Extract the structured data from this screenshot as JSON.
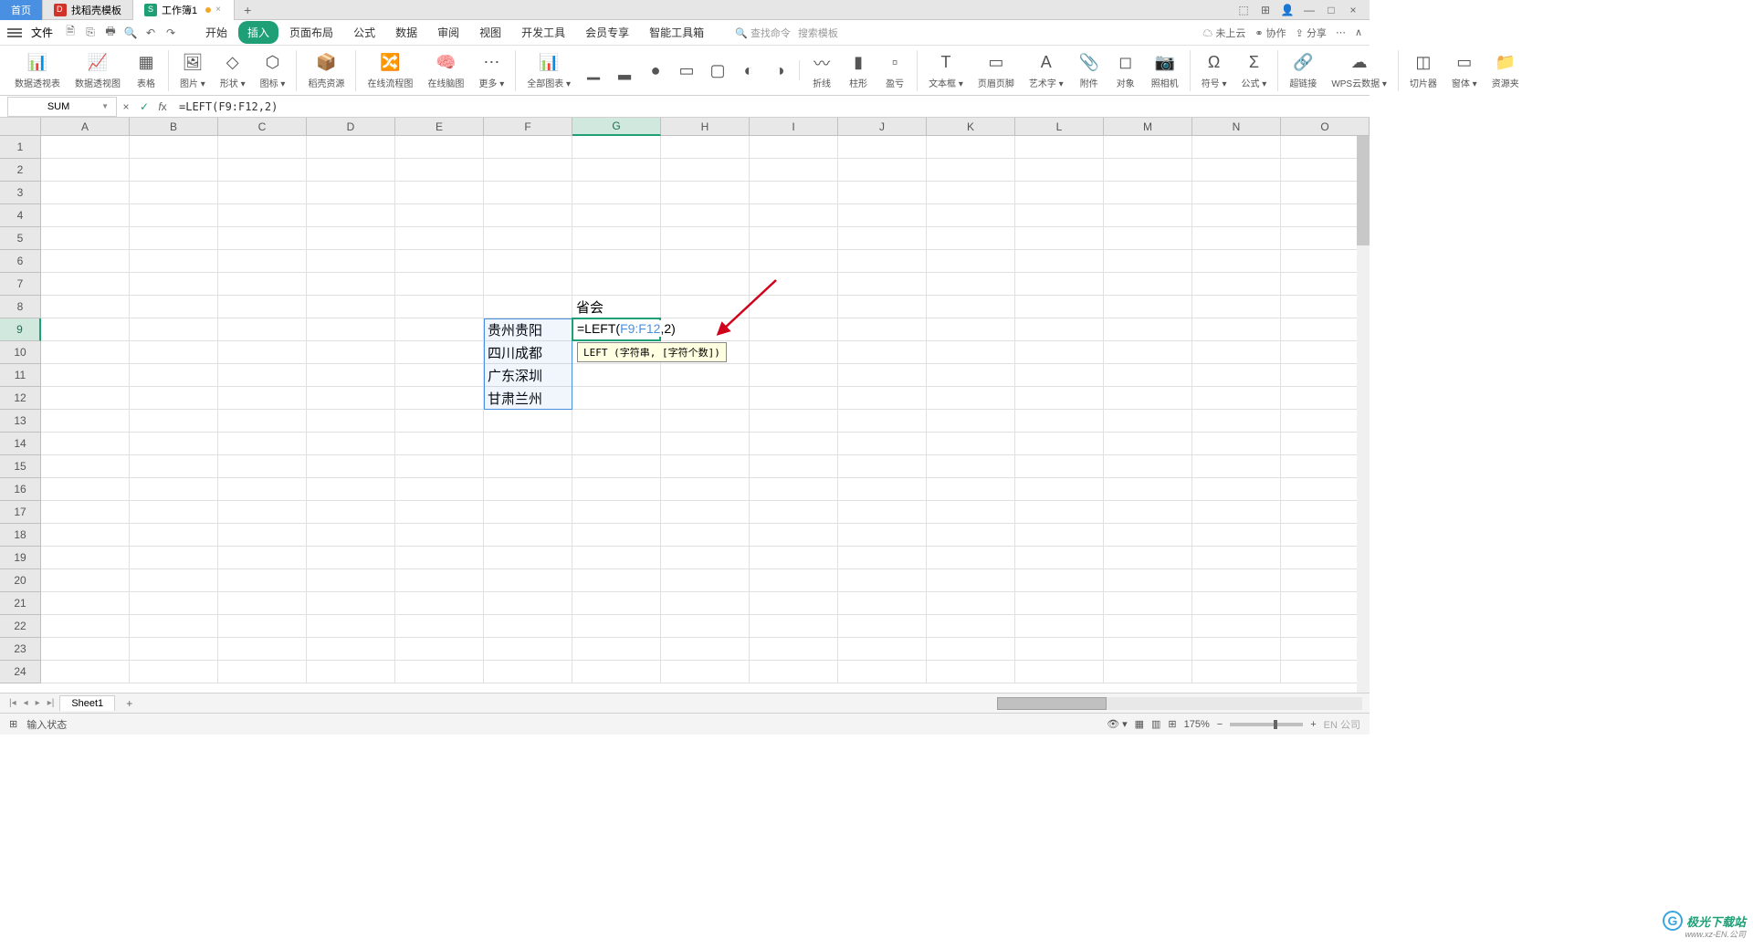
{
  "tabs": {
    "home": "首页",
    "docTemplate": "找稻壳模板",
    "workbook": "工作簿1"
  },
  "menu": {
    "file": "文件",
    "items": [
      "开始",
      "插入",
      "页面布局",
      "公式",
      "数据",
      "审阅",
      "视图",
      "开发工具",
      "会员专享",
      "智能工具箱"
    ],
    "activeIndex": 1,
    "searchCmd": "查找命令",
    "searchTpl": "搜索模板",
    "cloud": "未上云",
    "coop": "协作",
    "share": "分享"
  },
  "ribbon": [
    {
      "label": "数据透视表",
      "group": true
    },
    {
      "label": "数据透视图"
    },
    {
      "label": "表格",
      "sep": true
    },
    {
      "label": "图片"
    },
    {
      "label": "形状"
    },
    {
      "label": "图标",
      "sep": true
    },
    {
      "label": "稻壳资源",
      "sep": true
    },
    {
      "label": "在线流程图"
    },
    {
      "label": "在线脑图"
    },
    {
      "label": "更多",
      "sep": true
    },
    {
      "label": "全部图表"
    },
    {
      "label": "",
      "icon": true
    },
    {
      "label": "",
      "icon": true
    },
    {
      "label": "",
      "icon": true
    },
    {
      "label": "",
      "icon": true
    },
    {
      "label": "",
      "icon": true
    },
    {
      "label": "",
      "icon": true
    },
    {
      "label": "",
      "sep": true,
      "icon": true
    },
    {
      "label": "折线"
    },
    {
      "label": "柱形"
    },
    {
      "label": "盈亏",
      "sep": true
    },
    {
      "label": "文本框"
    },
    {
      "label": "页眉页脚"
    },
    {
      "label": "艺术字"
    },
    {
      "label": "附件"
    },
    {
      "label": "对象"
    },
    {
      "label": "照相机",
      "sep": true
    },
    {
      "label": "符号"
    },
    {
      "label": "公式",
      "sep": true
    },
    {
      "label": "超链接"
    },
    {
      "label": "WPS云数据",
      "sep": true
    },
    {
      "label": "切片器"
    },
    {
      "label": "窗体"
    },
    {
      "label": "资源夹"
    }
  ],
  "nameBox": "SUM",
  "formula": "=LEFT(F9:F12,2)",
  "columns": [
    "A",
    "B",
    "C",
    "D",
    "E",
    "F",
    "G",
    "H",
    "I",
    "J",
    "K",
    "L",
    "M",
    "N",
    "O"
  ],
  "rowCount": 24,
  "selectedCol": "G",
  "selectedRow": 9,
  "cells": {
    "G8": "省会",
    "F9": "贵州贵阳",
    "F10": "四川成都",
    "F11": "广东深圳",
    "F12": "甘肃兰州"
  },
  "editing": {
    "prefix": "=LEFT(",
    "ref": "F9:F12",
    "suffix": ",2)"
  },
  "tooltip": "LEFT (字符串, [字符个数])",
  "sheetTab": "Sheet1",
  "status": "输入状态",
  "zoom": "175%",
  "lang": "EN 公司",
  "watermark": "极光下载站",
  "watermarkUrl": "www.xz-EN.公司"
}
